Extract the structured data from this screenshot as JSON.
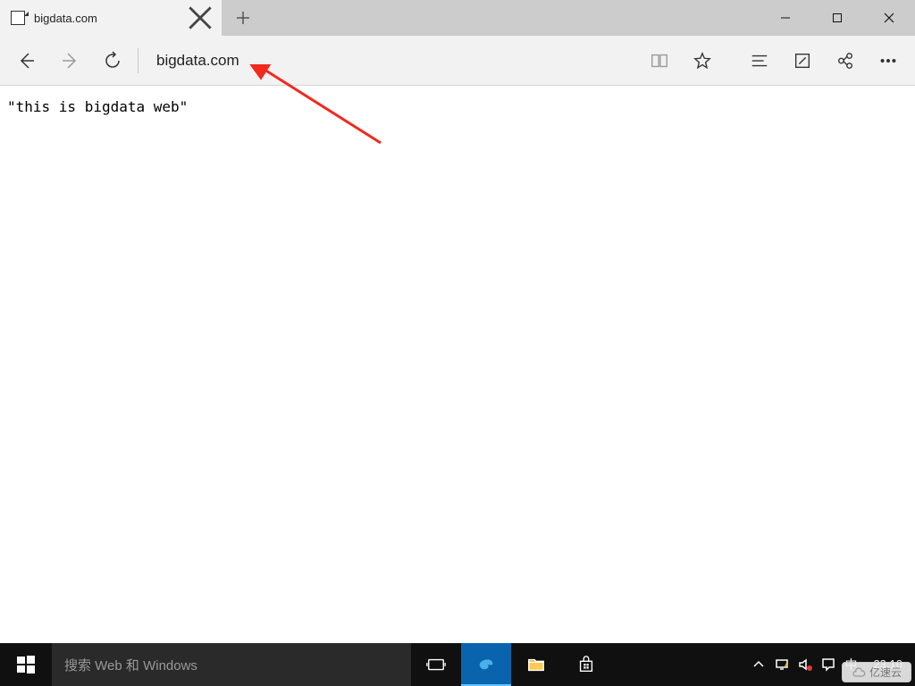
{
  "browser": {
    "tab": {
      "title": "bigdata.com"
    },
    "address": "bigdata.com",
    "page_text": "\"this is bigdata web\""
  },
  "taskbar": {
    "search_placeholder": "搜索 Web 和 Windows",
    "ime": "中",
    "time": "23:10"
  },
  "watermark": "亿速云"
}
